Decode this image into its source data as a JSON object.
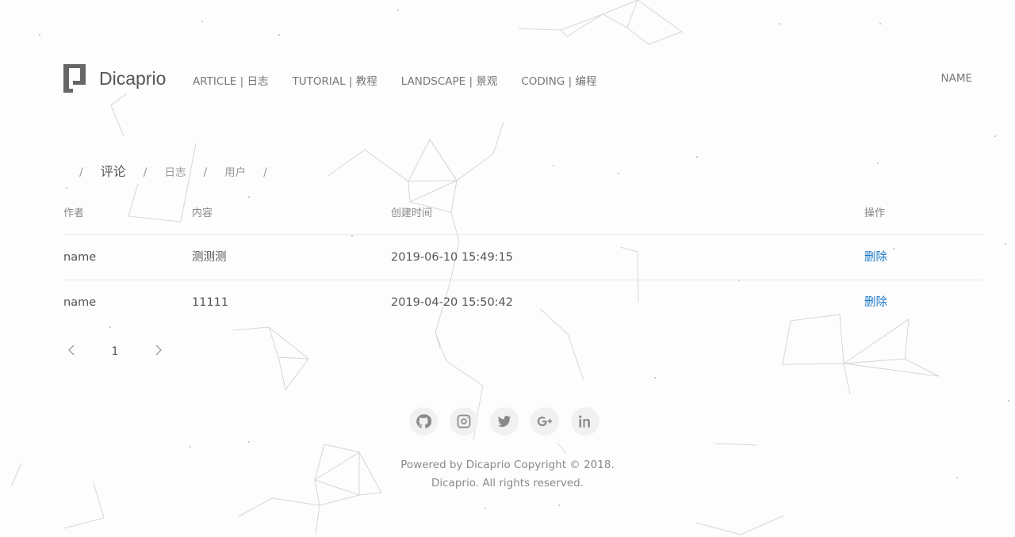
{
  "brand": {
    "name": "Dicaprio",
    "logo_icon": "dicaprio-logo-icon"
  },
  "nav": {
    "items": [
      {
        "label": "ARTICLE | 日志"
      },
      {
        "label": "TUTORIAL | 教程"
      },
      {
        "label": "LANDSCAPE | 景观"
      },
      {
        "label": "CODING | 编程"
      }
    ],
    "right_label": "NAME"
  },
  "tabs": {
    "separator": "/",
    "items": [
      {
        "label": "评论",
        "active": true
      },
      {
        "label": "日志",
        "active": false
      },
      {
        "label": "用户",
        "active": false
      }
    ]
  },
  "table": {
    "headers": [
      "作者",
      "内容",
      "创建时间",
      "操作"
    ],
    "rows": [
      {
        "author": "name",
        "content": "测测测",
        "created": "2019-06-10 15:49:15",
        "action": "删除"
      },
      {
        "author": "name",
        "content": "11111",
        "created": "2019-04-20 15:50:42",
        "action": "删除"
      }
    ]
  },
  "pagination": {
    "prev": "‹",
    "page": "1",
    "next": "›"
  },
  "social": [
    "github-icon",
    "instagram-icon",
    "twitter-icon",
    "google-plus-icon",
    "linkedin-icon"
  ],
  "footer": {
    "line1": "Powered by Dicaprio Copyright © 2018.",
    "line2": "Dicaprio. All rights reserved."
  },
  "colors": {
    "link": "#1e78c8",
    "text": "#555555",
    "muted": "#888888",
    "background": "#fdfdfd"
  }
}
